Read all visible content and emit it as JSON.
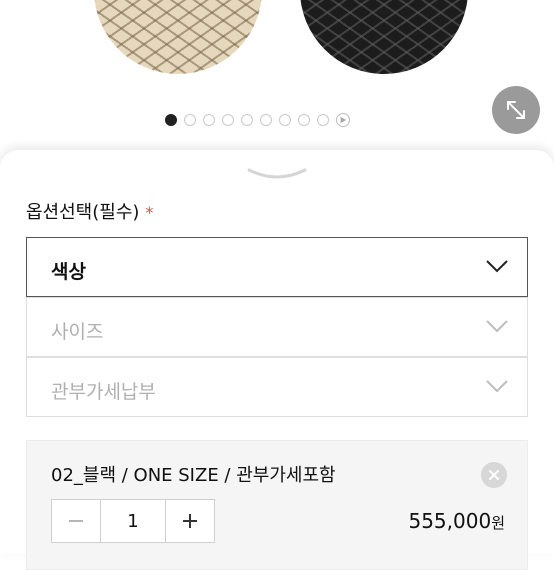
{
  "gallery": {
    "dot_count": 9,
    "active_index": 0,
    "icons": {
      "expand": "expand-arrows-icon",
      "play": "play-icon"
    }
  },
  "options": {
    "title": "옵션선택(필수)",
    "required_mark": "*",
    "selects": [
      {
        "label": "색상",
        "state": "active"
      },
      {
        "label": "사이즈",
        "state": "disabled"
      },
      {
        "label": "관부가세납부",
        "state": "disabled"
      }
    ]
  },
  "selected_item": {
    "name": "02_블랙 / ONE SIZE / 관부가세포함",
    "quantity": "1",
    "price": "555,000",
    "price_unit": "원"
  },
  "colors": {
    "required": "#e04848",
    "active_dot": "#222222",
    "expand_button": "#9a9a9a"
  }
}
